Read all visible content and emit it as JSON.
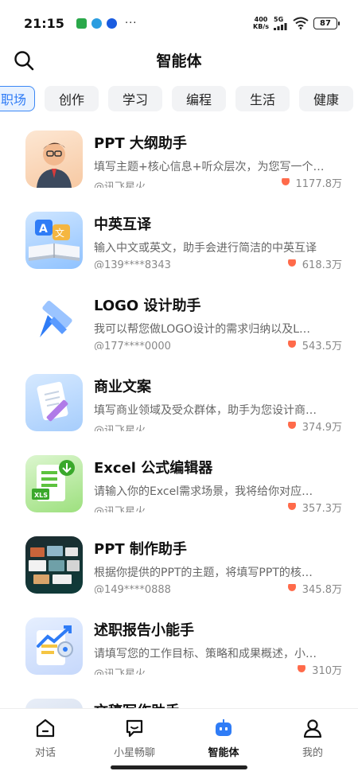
{
  "status": {
    "time": "21:15",
    "speed_top": "400",
    "speed_bottom": "KB/s",
    "network": "5G",
    "battery": "87"
  },
  "header": {
    "title": "智能体"
  },
  "tabs": [
    {
      "label": "职场",
      "active": true
    },
    {
      "label": "创作"
    },
    {
      "label": "学习"
    },
    {
      "label": "编程"
    },
    {
      "label": "生活"
    },
    {
      "label": "健康"
    }
  ],
  "items": [
    {
      "title": "PPT 大纲助手",
      "desc": "填写主题+核心信息+听众层次，为您写一个…",
      "author": "@讯飞星火",
      "heat": "1177.8万"
    },
    {
      "title": "中英互译",
      "desc": "输入中文或英文，助手会进行简洁的中英互译",
      "author": "@139****8343",
      "heat": "618.3万"
    },
    {
      "title": "LOGO 设计助手",
      "desc": "我可以帮您做LOGO设计的需求归纳以及L…",
      "author": "@177****0000",
      "heat": "543.5万"
    },
    {
      "title": "商业文案",
      "desc": "填写商业领域及受众群体，助手为您设计商…",
      "author": "@讯飞星火",
      "heat": "374.9万"
    },
    {
      "title": "Excel 公式编辑器",
      "desc": "请输入你的Excel需求场景，我将给你对应…",
      "author": "@讯飞星火",
      "heat": "357.3万"
    },
    {
      "title": "PPT 制作助手",
      "desc": "根据你提供的PPT的主题，将填写PPT的核…",
      "author": "@149****0888",
      "heat": "345.8万"
    },
    {
      "title": "述职报告小能手",
      "desc": "请填写您的工作目标、策略和成果概述，小…",
      "author": "@讯飞星火",
      "heat": "310万"
    },
    {
      "title": "文稿写作助手",
      "desc": "",
      "author": "",
      "heat": ""
    }
  ],
  "nav": [
    {
      "label": "对话",
      "icon": "home-icon"
    },
    {
      "label": "小星畅聊",
      "icon": "chat-bubble-icon"
    },
    {
      "label": "智能体",
      "icon": "agent-robot-icon",
      "active": true
    },
    {
      "label": "我的",
      "icon": "user-icon"
    }
  ]
}
